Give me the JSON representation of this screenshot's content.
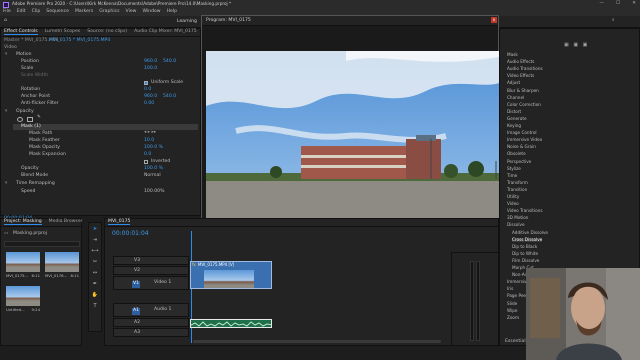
{
  "app": {
    "title": "Adobe Premiere Pro 2020 - C:\\Users\\Kirk McKenna\\Documents\\Adobe\\Premiere Pro\\14.0\\Masking.prproj *"
  },
  "menu": [
    "File",
    "Edit",
    "Clip",
    "Sequence",
    "Markers",
    "Graphics",
    "View",
    "Window",
    "Help"
  ],
  "workspace": {
    "learning": "Learning"
  },
  "effect_controls": {
    "tabs": [
      "Effect Controls",
      "Lumetri Scopes",
      "Source: (no clips)",
      "Audio Clip Mixer: MVI_0175"
    ],
    "clip_path": "Master * MVI_0175.MP4",
    "clip_active": "MVI_0175 * MVI_0175.MP4",
    "section_video": "Video",
    "motion": "Motion",
    "position": {
      "label": "Position",
      "x": "960.0",
      "y": "540.0"
    },
    "scale": {
      "label": "Scale",
      "value": "100.0"
    },
    "scale_width": "Scale Width",
    "uniform_scale": "Uniform Scale",
    "rotation": {
      "label": "Rotation",
      "value": "0.0"
    },
    "anchor": {
      "label": "Anchor Point",
      "x": "960.0",
      "y": "540.0"
    },
    "anti_flicker": {
      "label": "Anti-flicker Filter",
      "value": "0.00"
    },
    "opacity_section": "Opacity",
    "mask": "Mask (1)",
    "mask_path": "Mask Path",
    "mask_feather": {
      "label": "Mask Feather",
      "value": "10.0"
    },
    "mask_opacity": {
      "label": "Mask Opacity",
      "value": "100.0 %"
    },
    "mask_expansion": {
      "label": "Mask Expansion",
      "value": "0.0"
    },
    "inverted": "Inverted",
    "opacity": {
      "label": "Opacity",
      "value": "100.0 %"
    },
    "blend_mode": {
      "label": "Blend Mode",
      "value": "Normal"
    },
    "time_remap": "Time Remapping",
    "speed": {
      "label": "Speed",
      "value": "100.00%"
    },
    "timecode": "00:00:01:04"
  },
  "program": {
    "title": "Program: MVI_0175",
    "close": "x"
  },
  "effects": {
    "items": [
      "Mask",
      "Audio Effects",
      "Audio Transitions",
      "Video Effects",
      "Adjust",
      "Blur & Sharpen",
      "Channel",
      "Color Correction",
      "Distort",
      "Generate",
      "Keying",
      "Image Control",
      "Immersive Video",
      "Noise & Grain",
      "Obsolete",
      "Perspective",
      "Stylize",
      "Time",
      "Transform",
      "Transition",
      "Utility",
      "Video",
      "Video Transitions",
      "3D Motion",
      "Dissolve",
      "Additive Dissolve",
      "Cross Dissolve",
      "Dip to Black",
      "Dip to White",
      "Film Dissolve",
      "Morph Cut",
      "Non-Additive Dissolve",
      "Immersive Video",
      "Iris",
      "Page Peel",
      "Slide",
      "Wipe",
      "Zoom"
    ],
    "footer": "Essential Graphics"
  },
  "project": {
    "tabs": [
      "Project: Masking",
      "Media Browser"
    ],
    "name": "Masking.prproj",
    "items": [
      {
        "name": "MVI_0175...",
        "dur": "6:11"
      },
      {
        "name": "MVI_0176...",
        "dur": "6:11"
      },
      {
        "name": "Untitled...",
        "dur": "9:24"
      }
    ]
  },
  "timeline": {
    "tab": "MVI_0175",
    "timecode": "00:00:01:04",
    "tracks": [
      "V3",
      "V2",
      "V1",
      "A1",
      "A2",
      "A3"
    ],
    "clip_video": "MVI_0175.MP4 [V]",
    "clip_fx": "fx",
    "video1": "Video 1",
    "audio1": "Audio 1",
    "master": "Master"
  },
  "colors": {
    "accent": "#2d8ceb",
    "value_blue": "#3f9be8",
    "clip_blue": "#3a6fb0",
    "clip_purple": "#7b6bb0",
    "track_green": "#1f6f4a"
  }
}
